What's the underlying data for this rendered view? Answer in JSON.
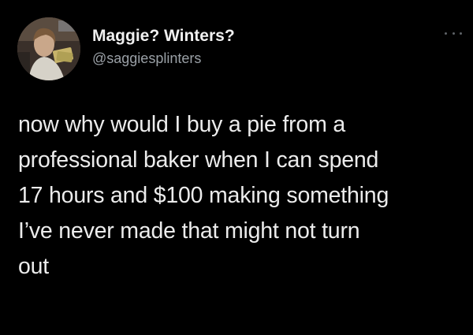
{
  "author": {
    "display_name": "Maggie? Winters?",
    "handle": "@saggiesplinters",
    "avatar_icon": "profile-photo"
  },
  "menu": {
    "icon": "more-horizontal-icon"
  },
  "tweet": {
    "lines": [
      "now why would I buy a pie from a",
      "professional baker when I can spend",
      "17 hours and $100 making something",
      "I’ve never made that might not turn",
      "out"
    ]
  },
  "colors": {
    "background": "#000000",
    "text_primary": "#e7e9ea",
    "text_secondary": "#9aa0a6"
  }
}
